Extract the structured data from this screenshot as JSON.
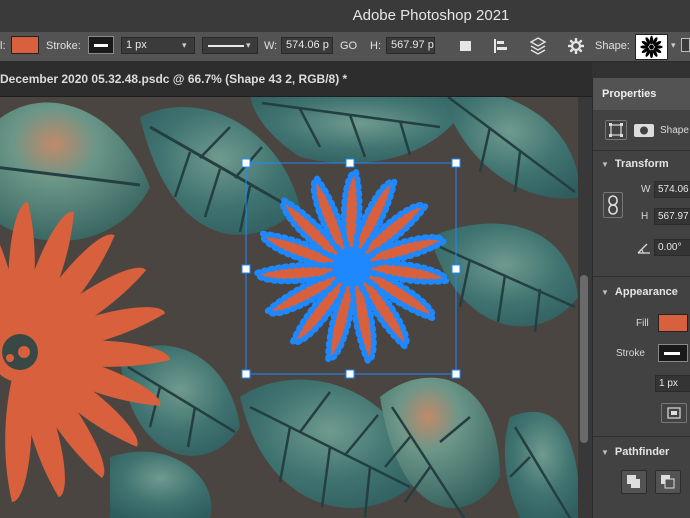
{
  "app": {
    "title": "Adobe Photoshop 2021"
  },
  "options_bar": {
    "stroke_label": "Stroke:",
    "stroke_width": "1 px",
    "w_label": "W:",
    "w_value": "574.06 p",
    "go_label": "GO",
    "h_label": "H:",
    "h_value": "567.97 p",
    "shape_label": "Shape:",
    "fill_color": "#d9603c"
  },
  "document": {
    "tab_name": "December 2020 05.32.48.psdc @ 66.7% (Shape 43 2, RGB/8) *"
  },
  "properties": {
    "tab_label": "Properties",
    "layer_type": "Shape",
    "transform": {
      "title": "Transform",
      "w_label": "W",
      "w_value": "574.06",
      "h_label": "H",
      "h_value": "567.97",
      "angle_value": "0.00°"
    },
    "appearance": {
      "title": "Appearance",
      "fill_label": "Fill",
      "stroke_label": "Stroke",
      "stroke_width": "1 px",
      "fill_color": "#d9603c"
    },
    "pathfinder": {
      "title": "Pathfinder"
    }
  },
  "colors": {
    "accent_selection": "#1e88ff",
    "flower": "#d9603c",
    "leaf": "#3d6f6e"
  }
}
